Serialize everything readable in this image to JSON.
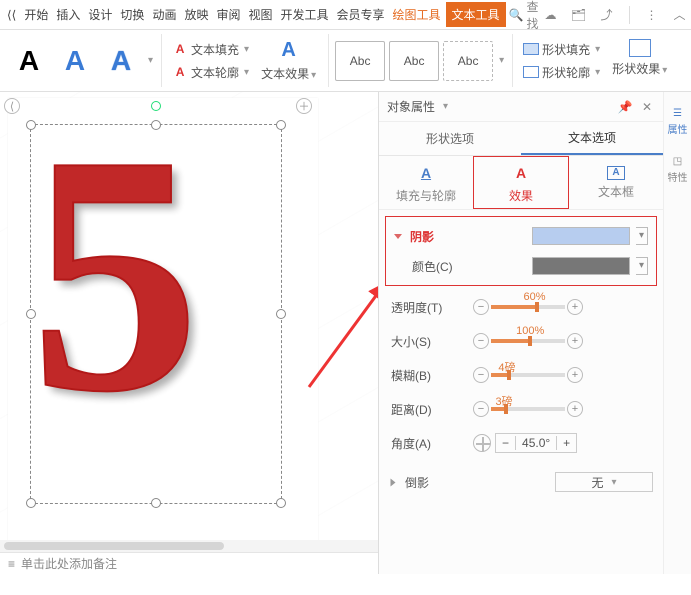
{
  "menu": {
    "items": [
      "开始",
      "插入",
      "设计",
      "切换",
      "动画",
      "放映",
      "审阅",
      "视图",
      "开发工具",
      "会员专享"
    ],
    "drawing_tool": "绘图工具",
    "text_tool": "文本工具",
    "search": "查找"
  },
  "ribbon": {
    "bigA": "A",
    "text_fill": "文本填充",
    "text_outline": "文本轮廓",
    "text_effect": "文本效果",
    "abc": "Abc",
    "shape_fill": "形状填充",
    "shape_outline": "形状轮廓",
    "shape_effect": "形状效果"
  },
  "canvas": {
    "glyph": "5"
  },
  "panel": {
    "title": "对象属性",
    "tab_shape": "形状选项",
    "tab_text": "文本选项",
    "sub_fill_outline": "填充与轮廓",
    "sub_effect": "效果",
    "sub_textbox": "文本框",
    "section_shadow": "阴影",
    "color_label": "颜色(C)",
    "props": {
      "opacity": {
        "label": "透明度(T)",
        "value": "60%",
        "fill": 60
      },
      "size": {
        "label": "大小(S)",
        "value": "100%",
        "fill": 100
      },
      "blur": {
        "label": "模糊(B)",
        "value": "4磅",
        "fill": 22
      },
      "dist": {
        "label": "距离(D)",
        "value": "3磅",
        "fill": 18
      },
      "angle": {
        "label": "角度(A)",
        "value": "45.0°"
      }
    },
    "section_reflect": "倒影",
    "reflect_value": "无"
  },
  "rail": {
    "props": "属性",
    "special": "特性"
  },
  "note_bar": "单击此处添加备注"
}
